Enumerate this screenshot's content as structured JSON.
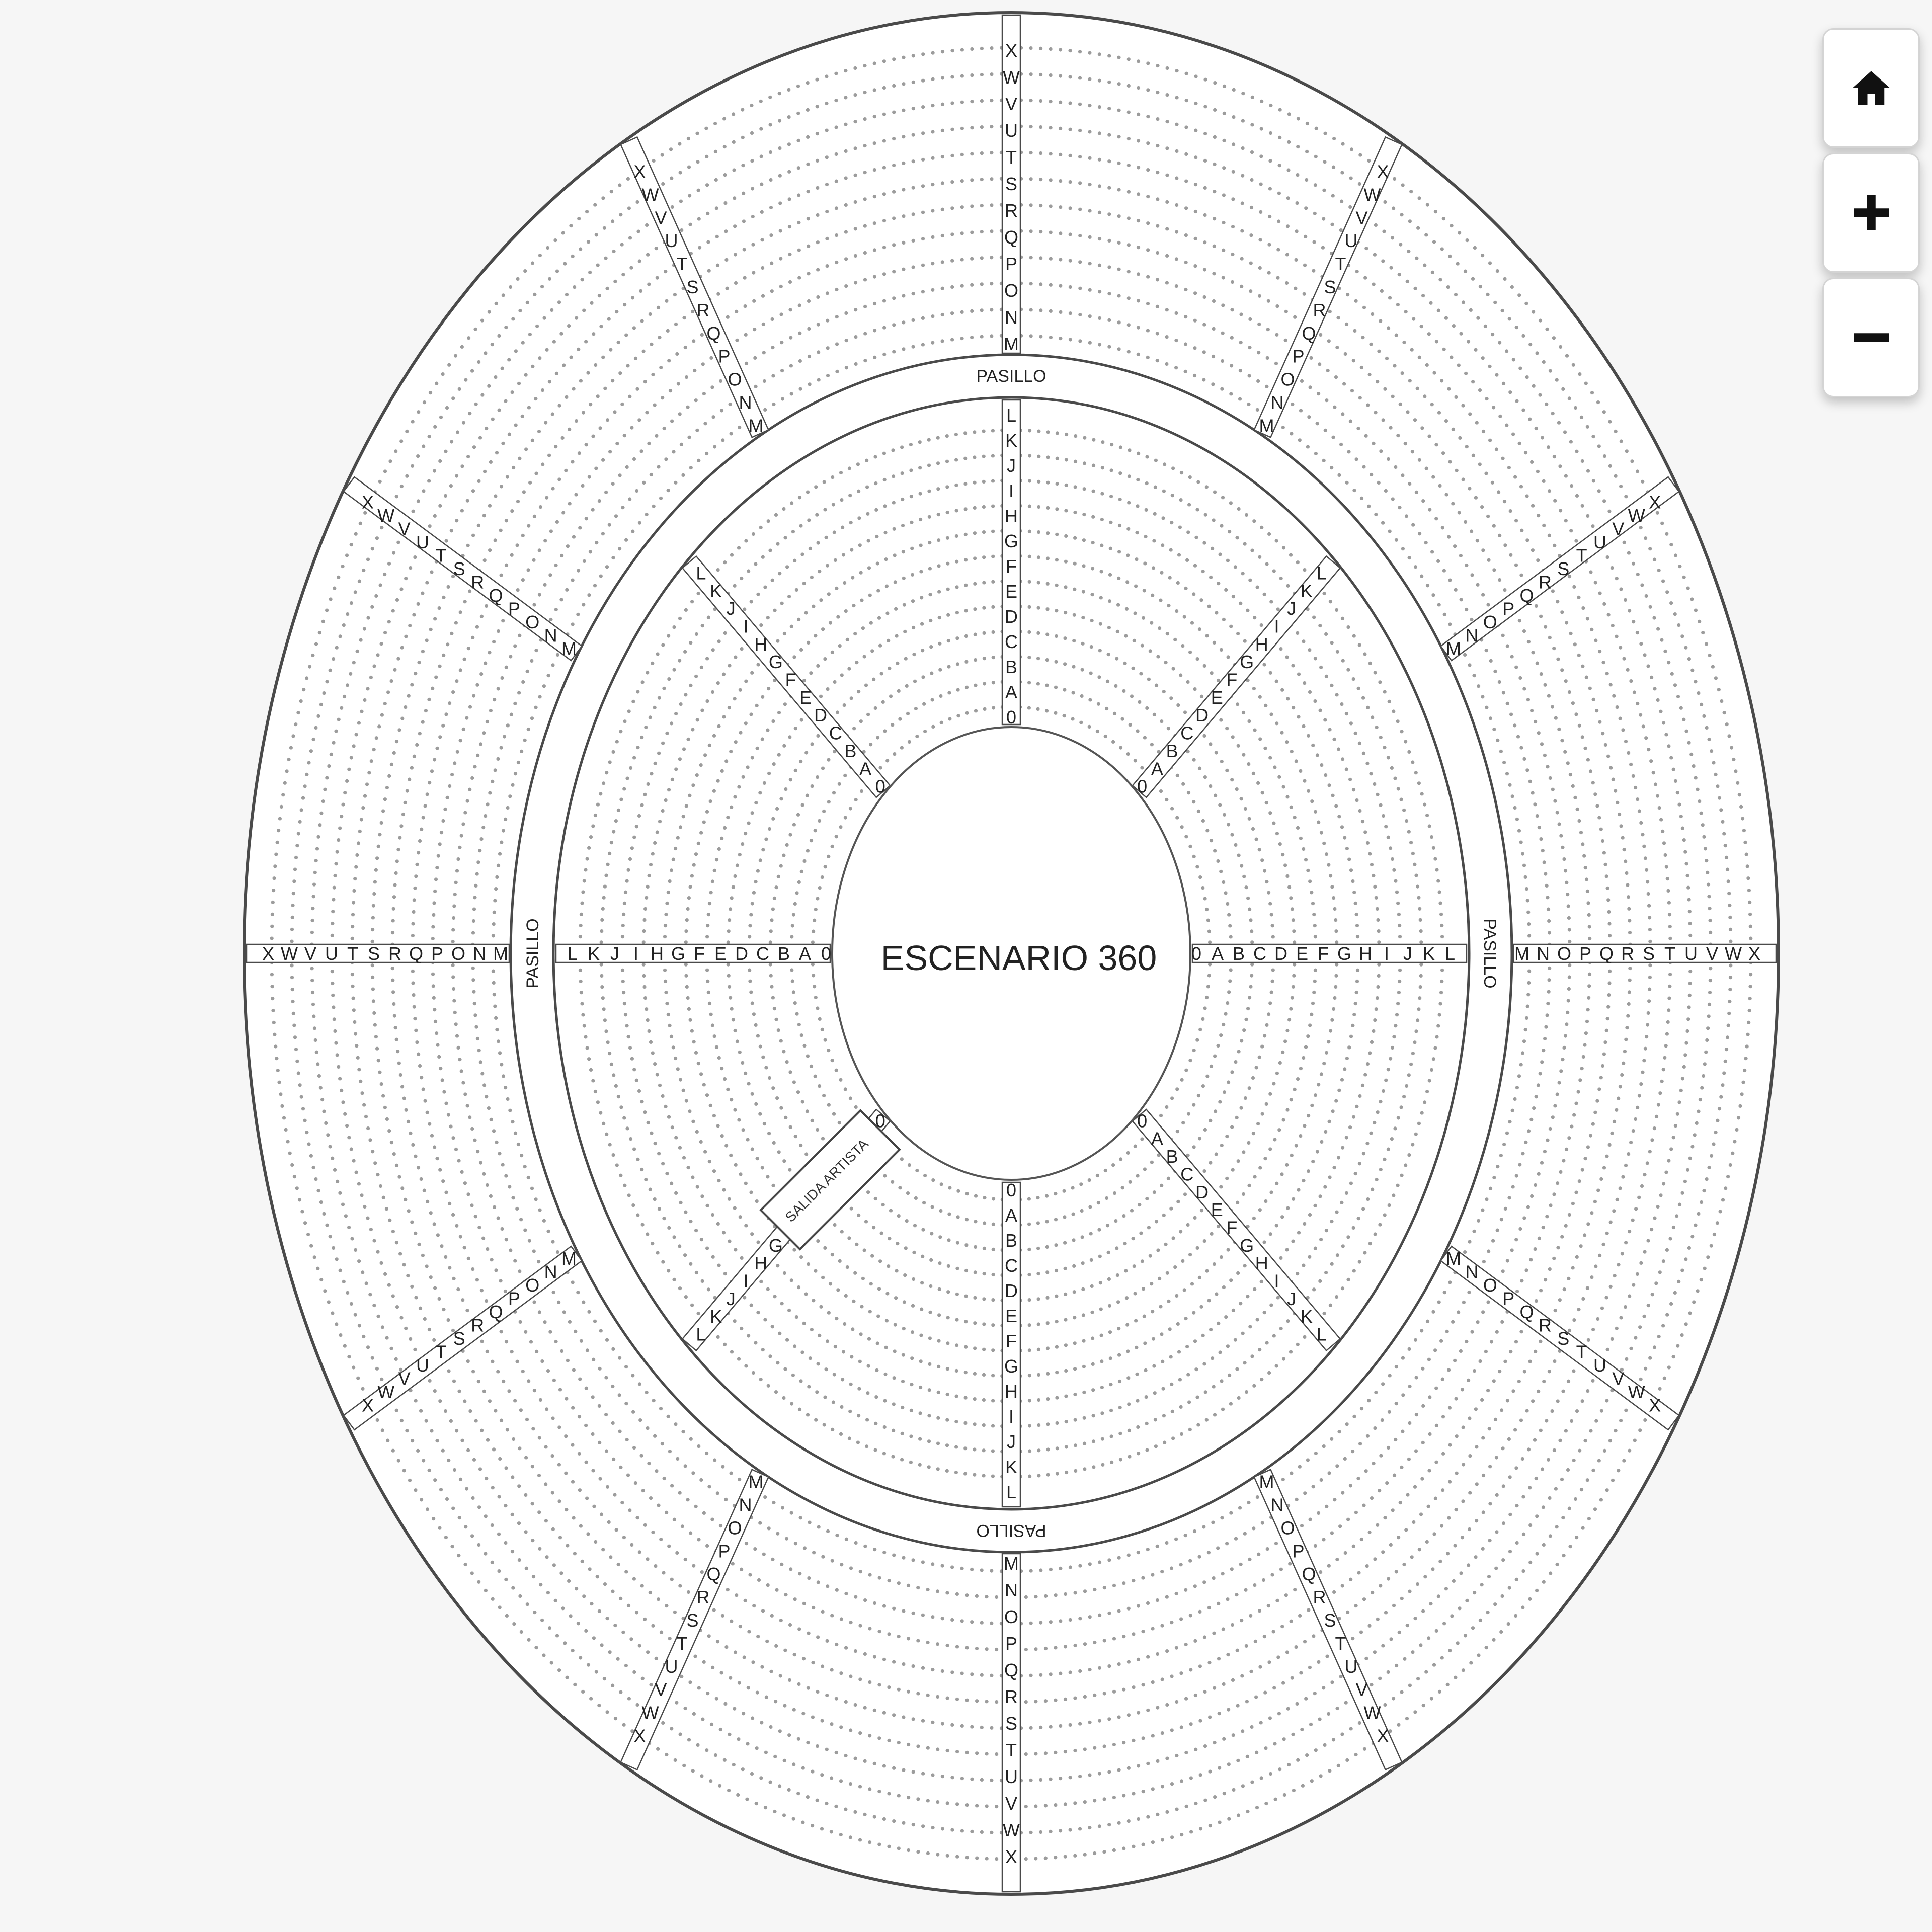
{
  "stage_label": "ESCENARIO 360",
  "aisle_label": "PASILLO",
  "artist_exit_label": "SALIDA ARTISTA",
  "inner_rows": [
    "0",
    "A",
    "B",
    "C",
    "D",
    "E",
    "F",
    "G",
    "H",
    "I",
    "J",
    "K",
    "L"
  ],
  "outer_rows": [
    "M",
    "N",
    "O",
    "P",
    "Q",
    "R",
    "S",
    "T",
    "U",
    "V",
    "W",
    "X"
  ],
  "controls": {
    "home_icon": "home-icon",
    "zoom_in_icon": "plus-icon",
    "zoom_out_icon": "minus-icon"
  },
  "colors": {
    "background": "#f6f6f6",
    "floor": "#ffffff",
    "seat": "#9c9c9c",
    "line": "#4a4a4a",
    "text": "#222222"
  }
}
